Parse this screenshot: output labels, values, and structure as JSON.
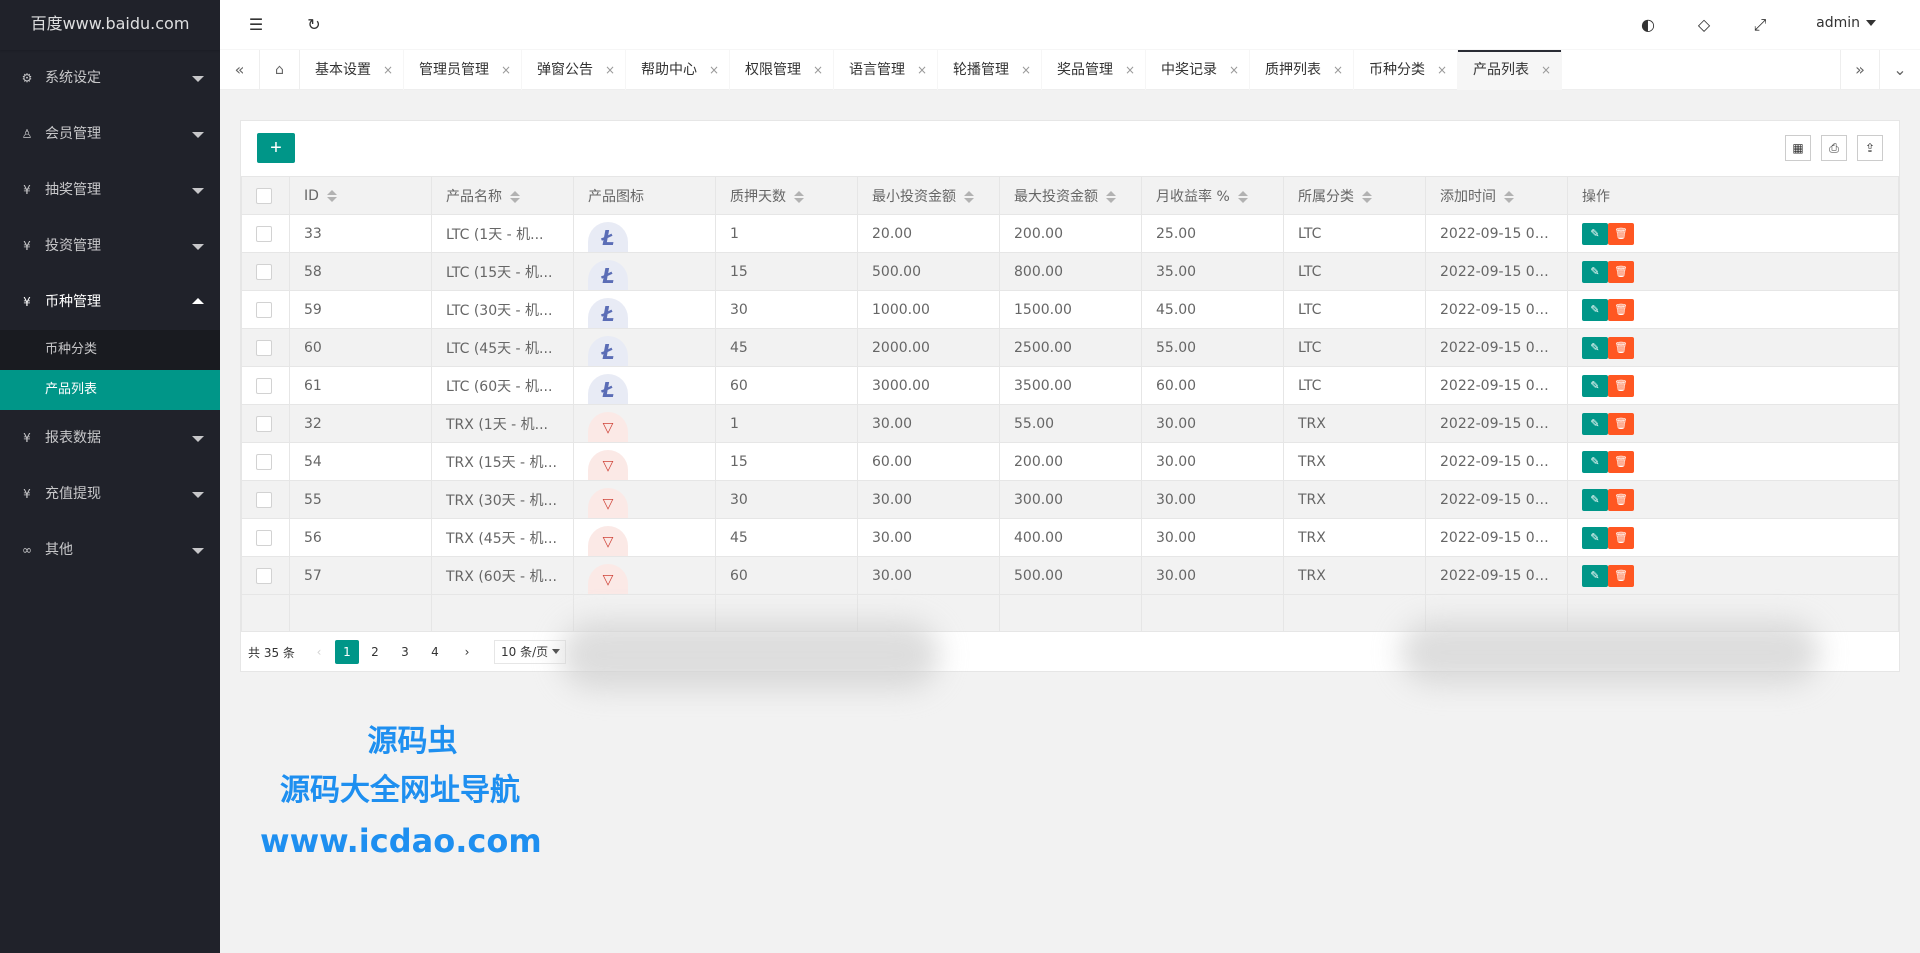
{
  "app": {
    "logo": "百度www.baidu.com"
  },
  "header": {
    "user": "admin"
  },
  "sidebar": {
    "items": [
      {
        "label": "系统设定",
        "icon": "gear-icon"
      },
      {
        "label": "会员管理",
        "icon": "user-icon"
      },
      {
        "label": "抽奖管理",
        "icon": "yen-icon"
      },
      {
        "label": "投资管理",
        "icon": "yen-icon"
      },
      {
        "label": "币种管理",
        "icon": "yen-icon",
        "open": true
      },
      {
        "label": "报表数据",
        "icon": "yen-icon"
      },
      {
        "label": "充值提现",
        "icon": "yen-icon"
      },
      {
        "label": "其他",
        "icon": "link-icon"
      }
    ],
    "sub_items": [
      "币种分类",
      "产品列表"
    ]
  },
  "tabs": [
    "基本设置",
    "管理员管理",
    "弹窗公告",
    "帮助中心",
    "权限管理",
    "语言管理",
    "轮播管理",
    "奖品管理",
    "中奖记录",
    "质押列表",
    "币种分类",
    "产品列表"
  ],
  "table": {
    "columns": [
      "ID",
      "产品名称",
      "产品图标",
      "质押天数",
      "最小投资金额",
      "最大投资金额",
      "月收益率 %",
      "所属分类",
      "添加时间",
      "操作"
    ],
    "rows": [
      {
        "id": "33",
        "name": "LTC (1天 - 机...",
        "icon": "ltc",
        "days": "1",
        "min": "20.00",
        "max": "200.00",
        "rate": "25.00",
        "cat": "LTC",
        "time": "2022-09-15 01..."
      },
      {
        "id": "58",
        "name": "LTC (15天 - 机...",
        "icon": "ltc",
        "days": "15",
        "min": "500.00",
        "max": "800.00",
        "rate": "35.00",
        "cat": "LTC",
        "time": "2022-09-15 01..."
      },
      {
        "id": "59",
        "name": "LTC (30天 - 机...",
        "icon": "ltc",
        "days": "30",
        "min": "1000.00",
        "max": "1500.00",
        "rate": "45.00",
        "cat": "LTC",
        "time": "2022-09-15 01..."
      },
      {
        "id": "60",
        "name": "LTC (45天 - 机...",
        "icon": "ltc",
        "days": "45",
        "min": "2000.00",
        "max": "2500.00",
        "rate": "55.00",
        "cat": "LTC",
        "time": "2022-09-15 01..."
      },
      {
        "id": "61",
        "name": "LTC (60天 - 机...",
        "icon": "ltc",
        "days": "60",
        "min": "3000.00",
        "max": "3500.00",
        "rate": "60.00",
        "cat": "LTC",
        "time": "2022-09-15 01..."
      },
      {
        "id": "32",
        "name": "TRX (1天 - 机...",
        "icon": "trx",
        "days": "1",
        "min": "30.00",
        "max": "55.00",
        "rate": "30.00",
        "cat": "TRX",
        "time": "2022-09-15 01..."
      },
      {
        "id": "54",
        "name": "TRX (15天 - 机...",
        "icon": "trx",
        "days": "15",
        "min": "60.00",
        "max": "200.00",
        "rate": "30.00",
        "cat": "TRX",
        "time": "2022-09-15 01..."
      },
      {
        "id": "55",
        "name": "TRX (30天 - 机...",
        "icon": "trx",
        "days": "30",
        "min": "30.00",
        "max": "300.00",
        "rate": "30.00",
        "cat": "TRX",
        "time": "2022-09-15 01..."
      },
      {
        "id": "56",
        "name": "TRX (45天 - 机...",
        "icon": "trx",
        "days": "45",
        "min": "30.00",
        "max": "400.00",
        "rate": "30.00",
        "cat": "TRX",
        "time": "2022-09-15 01..."
      },
      {
        "id": "57",
        "name": "TRX (60天 - 机...",
        "icon": "trx",
        "days": "60",
        "min": "30.00",
        "max": "500.00",
        "rate": "30.00",
        "cat": "TRX",
        "time": "2022-09-15 01..."
      }
    ]
  },
  "pager": {
    "total": "共 35 条",
    "pages": [
      "1",
      "2",
      "3",
      "4"
    ],
    "limit": "10 条/页"
  },
  "watermark": {
    "line1": "源码虫",
    "line2": "源码大全网址导航",
    "line3": "www.icdao.com"
  },
  "colors": {
    "primary": "#009688",
    "danger": "#ff5722",
    "sidebar": "#20222a"
  }
}
